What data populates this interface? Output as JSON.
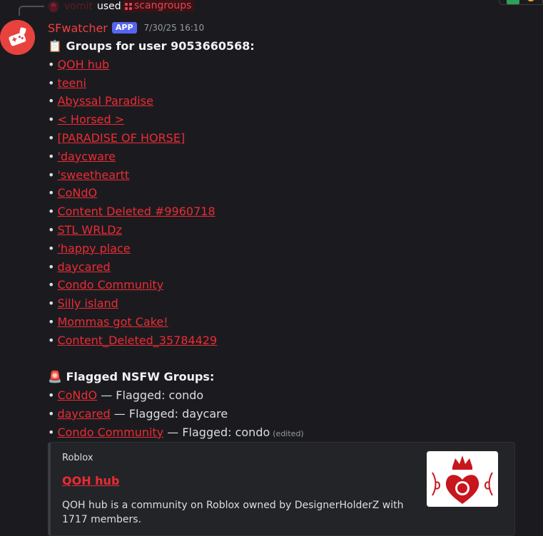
{
  "reply": {
    "user": "vomit",
    "used_text": "used",
    "command": "scangroups"
  },
  "message": {
    "username": "SFwatcher",
    "badge": "APP",
    "timestamp": "7/30/25 16:10",
    "heading_emoji": "📋",
    "heading": "Groups for user 9053660568:",
    "groups": [
      "QOH hub",
      "teeni",
      "Abyssal Paradise",
      "< Horsed >",
      "[PARADISE OF HORSE]",
      "'daycware",
      "'sweetheartt",
      "CoNdO",
      "Content Deleted #9960718",
      "STL WRLDz",
      "'happy place",
      "daycared",
      "Condo Community",
      "Silly island",
      "Mommas got Cake!",
      "Content_Deleted_35784429"
    ],
    "flagged_emoji": "🚨",
    "flagged_heading": "Flagged NSFW Groups:",
    "flagged": [
      {
        "name": "CoNdO",
        "suffix": " — Flagged: condo"
      },
      {
        "name": "daycared",
        "suffix": " — Flagged: daycare"
      },
      {
        "name": "Condo Community",
        "suffix": " — Flagged: condo"
      }
    ],
    "edited": "(edited)"
  },
  "embed": {
    "provider": "Roblox",
    "title": "QOH hub",
    "description": "QOH hub is a community on Roblox owned by DesignerHolderZ with 1717 members."
  },
  "colors": {
    "link": "#ec2b34",
    "username": "#f23f42",
    "badge": "#5865f2",
    "background": "#1b1b1f"
  }
}
